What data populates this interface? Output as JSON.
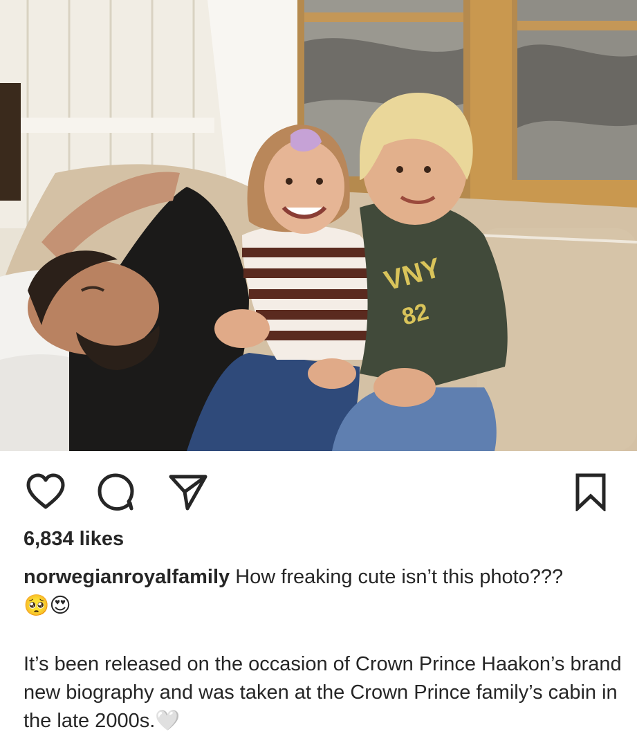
{
  "post": {
    "likes_text": "6,834 likes",
    "username": "norwegianroyalfamily",
    "caption_line1": "How freaking cute isn’t this photo???",
    "caption_emojis": "🥺😍",
    "caption_body": "It’s been released on the occasion of Crown Prince Haakon’s brand new biography and was taken at the Crown Prince family’s cabin in the late 2000s.🤍",
    "sweatshirt_print_top": "VNY",
    "sweatshirt_print_bottom": "82"
  },
  "icons": {
    "like": "heart-icon",
    "comment": "comment-icon",
    "share": "send-icon",
    "save": "bookmark-icon"
  },
  "colors": {
    "text": "#262626",
    "background": "#ffffff"
  }
}
